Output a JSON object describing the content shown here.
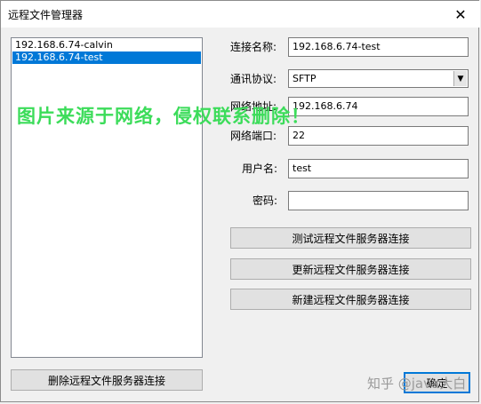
{
  "window": {
    "title": "远程文件管理器",
    "close_glyph": "✕"
  },
  "connections": [
    {
      "label": "192.168.6.74-calvin",
      "selected": false
    },
    {
      "label": "192.168.6.74-test",
      "selected": true
    }
  ],
  "form": {
    "name_label": "连接名称:",
    "name_value": "192.168.6.74-test",
    "protocol_label": "通讯协议:",
    "protocol_value": "SFTP",
    "address_label": "网络地址:",
    "address_value": "192.168.6.74",
    "port_label": "网络端口:",
    "port_value": "22",
    "user_label": "用户名:",
    "user_value": "test",
    "password_label": "密码:",
    "password_value": ""
  },
  "buttons": {
    "test": "测试远程文件服务器连接",
    "update": "更新远程文件服务器连接",
    "create": "新建远程文件服务器连接",
    "delete": "删除远程文件服务器连接",
    "ok": "确定"
  },
  "watermark": {
    "text": "图片来源于网络，侵权联系删除！",
    "color": "#3cdc5a"
  },
  "zhihu_watermark": "知乎 @java大白",
  "colors": {
    "selection": "#0078d7",
    "face": "#f0f0f0"
  }
}
